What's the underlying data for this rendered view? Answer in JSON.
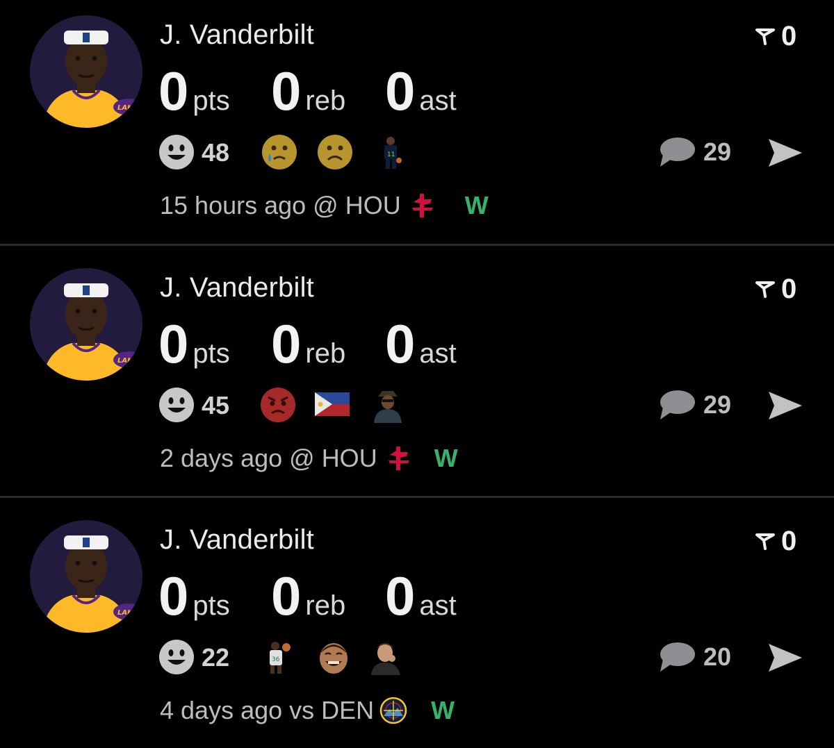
{
  "posts": [
    {
      "player_name": "J. Vanderbilt",
      "stats": [
        {
          "value": "0",
          "unit": "pts"
        },
        {
          "value": "0",
          "unit": "reb"
        },
        {
          "value": "0",
          "unit": "ast"
        }
      ],
      "flag_count": "0",
      "reaction_count": "48",
      "reactions": [
        "sad-tear-emoji",
        "frowning-emoji",
        "player-sticker"
      ],
      "comment_count": "29",
      "time_ago": "15 hours ago",
      "matchup": "@ HOU",
      "opponent_logo": "rockets-logo",
      "result": "W"
    },
    {
      "player_name": "J. Vanderbilt",
      "stats": [
        {
          "value": "0",
          "unit": "pts"
        },
        {
          "value": "0",
          "unit": "reb"
        },
        {
          "value": "0",
          "unit": "ast"
        }
      ],
      "flag_count": "0",
      "reaction_count": "45",
      "reactions": [
        "angry-emoji",
        "philippines-flag",
        "person-sticker"
      ],
      "comment_count": "29",
      "time_ago": "2 days ago",
      "matchup": "@ HOU",
      "opponent_logo": "rockets-logo",
      "result": "W"
    },
    {
      "player_name": "J. Vanderbilt",
      "stats": [
        {
          "value": "0",
          "unit": "pts"
        },
        {
          "value": "0",
          "unit": "reb"
        },
        {
          "value": "0",
          "unit": "ast"
        }
      ],
      "flag_count": "0",
      "reaction_count": "22",
      "reactions": [
        "player-sticker",
        "laughing-man-sticker",
        "person-sticker"
      ],
      "comment_count": "20",
      "time_ago": "4 days ago",
      "matchup": "vs DEN",
      "opponent_logo": "nuggets-logo",
      "result": "W"
    }
  ],
  "colors": {
    "background": "#000000",
    "divider": "#2a2a2c",
    "win": "#36b36a",
    "rockets_red": "#ce1141",
    "lakers_gold": "#fdb927",
    "avatar_bg": "#221b3d"
  }
}
